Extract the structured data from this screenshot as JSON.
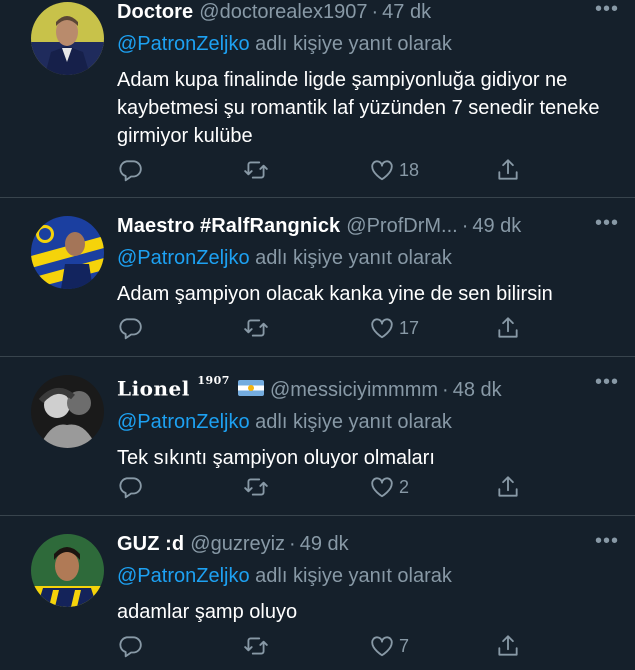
{
  "reply_prefix": "adlı kişiye yanıt olarak",
  "colors": {
    "background": "#15202b",
    "mention": "#1da1f2",
    "muted": "#8899a6",
    "divider": "#38444d"
  },
  "tweets": [
    {
      "name": "Doctore",
      "handle": "@doctorealex1907",
      "separator": "·",
      "time": "47 dk",
      "mention": "@PatronZeljko",
      "text": "Adam kupa finalinde ligde şampiyonluğa gidiyor ne kaybetmesi şu romantik laf yüzünden 7 senedir teneke girmiyor kulübe",
      "likes": "18"
    },
    {
      "name": "Maestro #RalfRangnick",
      "handle": "@ProfDrM...",
      "separator": "·",
      "time": "49 dk",
      "mention": "@PatronZeljko",
      "text": "Adam şampiyon olacak kanka yine de sen bilirsin",
      "likes": "17"
    },
    {
      "name": "Lionel",
      "name_sup": "1907",
      "flag_icon": "argentina-flag-icon",
      "handle": "@messiciyimmmm",
      "separator": "·",
      "time": "48 dk",
      "mention": "@PatronZeljko",
      "text": "Tek sıkıntı şampiyon oluyor olmaları",
      "likes": "2"
    },
    {
      "name": "GUZ :d",
      "handle": "@guzreyiz",
      "separator": "·",
      "time": "49 dk",
      "mention": "@PatronZeljko",
      "text": "adamlar şamp oluyo",
      "likes": "7"
    }
  ],
  "icons": {
    "more": "more-dots-icon",
    "reply": "reply-icon",
    "retweet": "retweet-icon",
    "like": "heart-icon",
    "share": "share-icon"
  },
  "more_glyph": "•••"
}
